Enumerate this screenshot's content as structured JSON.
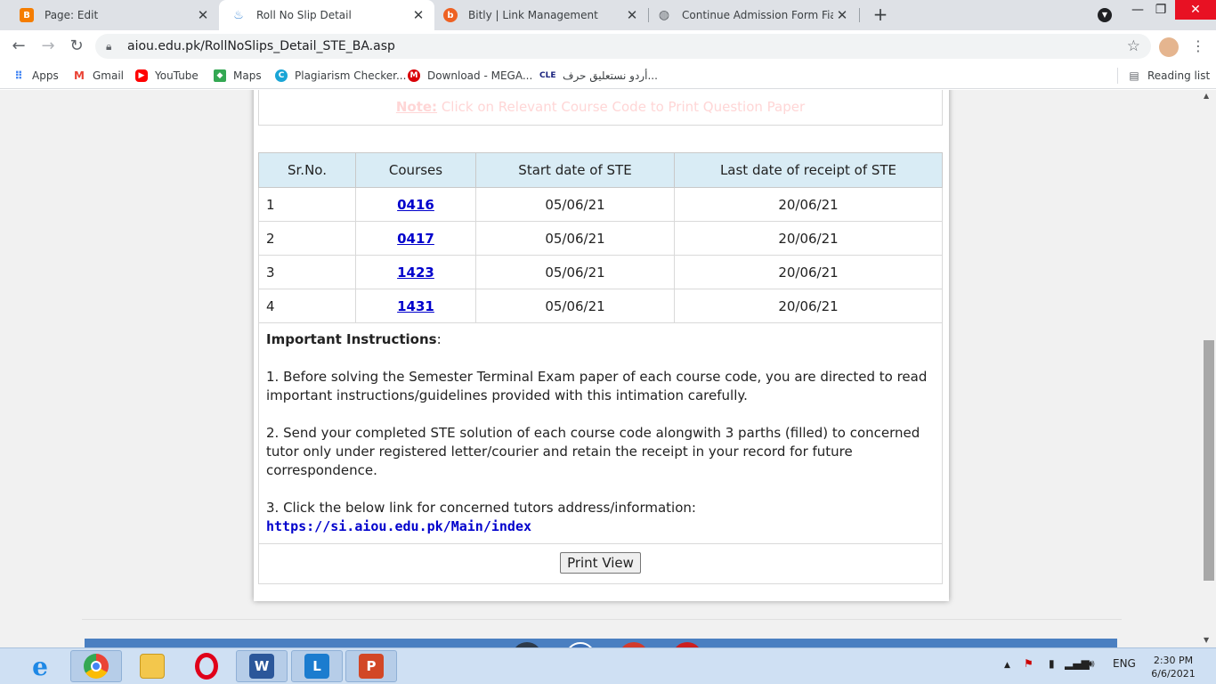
{
  "browser": {
    "tabs": [
      {
        "title": "Page: Edit",
        "icon": "blogger-icon",
        "color": "#f57d00",
        "active": false
      },
      {
        "title": "Roll No Slip Detail",
        "icon": "aiou-icon",
        "color": "#4a90d9",
        "active": true
      },
      {
        "title": "Bitly | Link Management",
        "icon": "bitly-icon",
        "color": "#ee6123",
        "active": false
      },
      {
        "title": "Continue Admission Form Fiaz ur",
        "icon": "globe-icon",
        "color": "#5f6368",
        "active": false
      }
    ],
    "url": "aiou.edu.pk/RollNoSlips_Detail_STE_BA.asp",
    "bookmarks": [
      {
        "label": "Apps",
        "icon": "apps-grid-icon"
      },
      {
        "label": "Gmail",
        "icon": "gmail-icon"
      },
      {
        "label": "YouTube",
        "icon": "youtube-icon"
      },
      {
        "label": "Maps",
        "icon": "maps-icon"
      },
      {
        "label": "Plagiarism Checker...",
        "icon": "plagiarism-icon"
      },
      {
        "label": "Download - MEGA...",
        "icon": "mega-icon"
      },
      {
        "label": "أردو نستعليق حرف...",
        "icon": "cle-icon"
      }
    ],
    "reading_list": "Reading list"
  },
  "page": {
    "note": {
      "label": "Note:",
      "text": " Click on Relevant Course Code to Print Question Paper"
    },
    "table": {
      "headers": [
        "Sr.No.",
        "Courses",
        "Start date of STE",
        "Last date of receipt of STE"
      ],
      "rows": [
        {
          "sr": "1",
          "course": "0416 ",
          "start": "05/06/21",
          "last": "20/06/21"
        },
        {
          "sr": "2",
          "course": "0417 ",
          "start": "05/06/21",
          "last": "20/06/21"
        },
        {
          "sr": "3",
          "course": "1423 ",
          "start": "05/06/21",
          "last": "20/06/21"
        },
        {
          "sr": "4",
          "course": "1431 ",
          "start": "05/06/21",
          "last": "20/06/21"
        }
      ]
    },
    "instructions": {
      "heading": "Important Instructions",
      "colon": ":",
      "items": [
        "1. Before solving the Semester Terminal Exam paper of each course code, you are directed to read important instructions/guidelines provided with this intimation carefully.",
        "2. Send your completed STE solution of each course code alongwith 3 parths (filled) to concerned tutor only under registered letter/courier and retain the receipt in your record for future correspondence.",
        "3. Click the below link for concerned tutors address/information:"
      ],
      "link": "https://si.aiou.edu.pk/Main/index"
    },
    "print_button": "Print View"
  },
  "taskbar": {
    "tray_lang": "ENG",
    "time": "2:30 PM",
    "date": "6/6/2021"
  }
}
